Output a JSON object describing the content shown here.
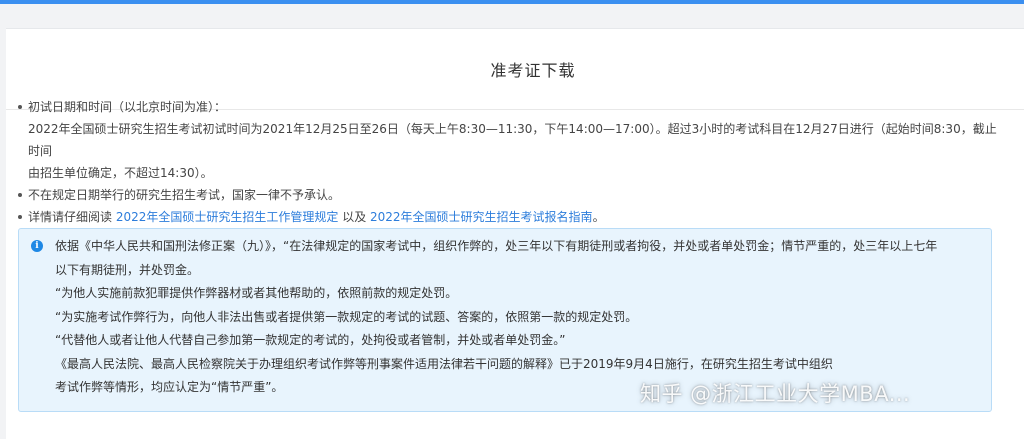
{
  "header": {
    "title": "准考证下载"
  },
  "bullets": [
    {
      "label": "初试日期和时间（以北京时间为准）："
    },
    {
      "label": "不在规定日期举行的研究生招生考试，国家一律不予承认。"
    }
  ],
  "exam_schedule": {
    "line1": "2022年全国硕士研究生招生考试初试时间为2021年12月25日至26日（每天上午8:30—11:30，下午14:00—17:00）。超过3小时的考试科目在12月27日进行（起始时间8:30，截止时间",
    "line2": "由招生单位确定，不超过14:30）。"
  },
  "read_more": {
    "prefix": "详情请仔细阅读 ",
    "link1": "2022年全国硕士研究生招生工作管理规定",
    "middle": " 以及 ",
    "link2": "2022年全国硕士研究生招生考试报名指南",
    "suffix": "。"
  },
  "notice": {
    "icon": "info-icon",
    "accent": "#1e88e5",
    "lines": [
      "依据《中华人民共和国刑法修正案（九）》，“在法律规定的国家考试中，组织作弊的，处三年以下有期徒刑或者拘役，并处或者单处罚金；情节严重的，处三年以上七年",
      "以下有期徒刑，并处罚金。",
      "“为他人实施前款犯罪提供作弊器材或者其他帮助的，依照前款的规定处罚。",
      "“为实施考试作弊行为，向他人非法出售或者提供第一款规定的考试的试题、答案的，依照第一款的规定处罚。",
      "“代替他人或者让他人代替自己参加第一款规定的考试的，处拘役或者管制，并处或者单处罚金。”",
      "《最高人民法院、最高人民检察院关于办理组织考试作弊等刑事案件适用法律若干问题的解释》已于2019年9月4日施行，在研究生招生考试中组织",
      "考试作弊等情形，均应认定为“情节严重”。"
    ]
  },
  "watermark": {
    "text": "知乎 @浙江工业大学MBA..."
  }
}
